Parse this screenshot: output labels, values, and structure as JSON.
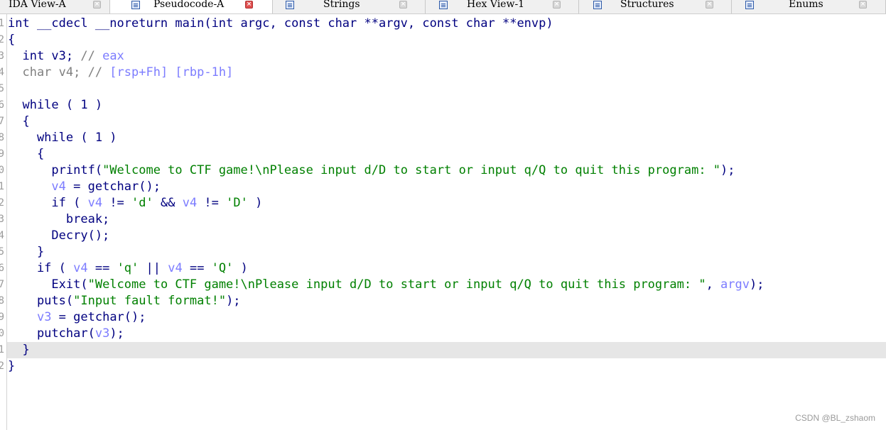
{
  "tabs": [
    {
      "label": "IDA View-A",
      "icon": "",
      "active": false,
      "close": "×"
    },
    {
      "label": "Pseudocode-A",
      "icon": "pseudocode-icon",
      "active": true,
      "close": "×"
    },
    {
      "label": "Strings",
      "icon": "strings-icon",
      "active": false,
      "close": "×"
    },
    {
      "label": "Hex View-1",
      "icon": "hex-view-icon",
      "active": false,
      "close": "×"
    },
    {
      "label": "Structures",
      "icon": "structures-icon",
      "active": false,
      "close": "×"
    },
    {
      "label": "Enums",
      "icon": "enums-icon",
      "active": false,
      "close": "×"
    }
  ],
  "gutter": [
    "1",
    "2",
    "3",
    "4",
    "5",
    "6",
    "7",
    "8",
    "9",
    "0",
    "1",
    "2",
    "3",
    "4",
    "5",
    "6",
    "7",
    "8",
    "9",
    "0",
    "1",
    "2"
  ],
  "code_lines": [
    [
      [
        "p",
        "int __cdecl __noreturn main(int argc, const char **argv, const char **envp)"
      ]
    ],
    [
      [
        "p",
        "{"
      ]
    ],
    [
      [
        "p",
        "  int v3; "
      ],
      [
        "c",
        "// "
      ],
      [
        "v",
        "eax"
      ]
    ],
    [
      [
        "c",
        "  char v4; // "
      ],
      [
        "v",
        "[rsp+Fh] [rbp-1h]"
      ]
    ],
    [],
    [
      [
        "p",
        "  while ( 1 )"
      ]
    ],
    [
      [
        "p",
        "  {"
      ]
    ],
    [
      [
        "p",
        "    while ( 1 )"
      ]
    ],
    [
      [
        "p",
        "    {"
      ]
    ],
    [
      [
        "p",
        "      printf("
      ],
      [
        "s",
        "\"Welcome to CTF game!\\nPlease input d/D to start or input q/Q to quit this program: \""
      ],
      [
        "p",
        ");"
      ]
    ],
    [
      [
        "p",
        "      "
      ],
      [
        "v",
        "v4"
      ],
      [
        "p",
        " = getchar();"
      ]
    ],
    [
      [
        "p",
        "      if ( "
      ],
      [
        "v",
        "v4"
      ],
      [
        "p",
        " != "
      ],
      [
        "s",
        "'d'"
      ],
      [
        "p",
        " && "
      ],
      [
        "v",
        "v4"
      ],
      [
        "p",
        " != "
      ],
      [
        "s",
        "'D'"
      ],
      [
        "p",
        " )"
      ]
    ],
    [
      [
        "p",
        "        break;"
      ]
    ],
    [
      [
        "p",
        "      Decry();"
      ]
    ],
    [
      [
        "p",
        "    }"
      ]
    ],
    [
      [
        "p",
        "    if ( "
      ],
      [
        "v",
        "v4"
      ],
      [
        "p",
        " == "
      ],
      [
        "s",
        "'q'"
      ],
      [
        "p",
        " || "
      ],
      [
        "v",
        "v4"
      ],
      [
        "p",
        " == "
      ],
      [
        "s",
        "'Q'"
      ],
      [
        "p",
        " )"
      ]
    ],
    [
      [
        "p",
        "      Exit("
      ],
      [
        "s",
        "\"Welcome to CTF game!\\nPlease input d/D to start or input q/Q to quit this program: \""
      ],
      [
        "p",
        ", "
      ],
      [
        "v",
        "argv"
      ],
      [
        "p",
        ");"
      ]
    ],
    [
      [
        "p",
        "    puts("
      ],
      [
        "s",
        "\"Input fault format!\""
      ],
      [
        "p",
        ");"
      ]
    ],
    [
      [
        "p",
        "    "
      ],
      [
        "v",
        "v3"
      ],
      [
        "p",
        " = getchar();"
      ]
    ],
    [
      [
        "p",
        "    putchar("
      ],
      [
        "v",
        "v3"
      ],
      [
        "p",
        ");"
      ]
    ],
    [
      [
        "p",
        "  }"
      ]
    ],
    [
      [
        "p",
        "}"
      ]
    ]
  ],
  "current_line": 20,
  "colors": {
    "keyword": "#000080",
    "variable": "#7c7cff",
    "string": "#008000",
    "comment": "#808080"
  },
  "watermark": "CSDN @BL_zshaom"
}
